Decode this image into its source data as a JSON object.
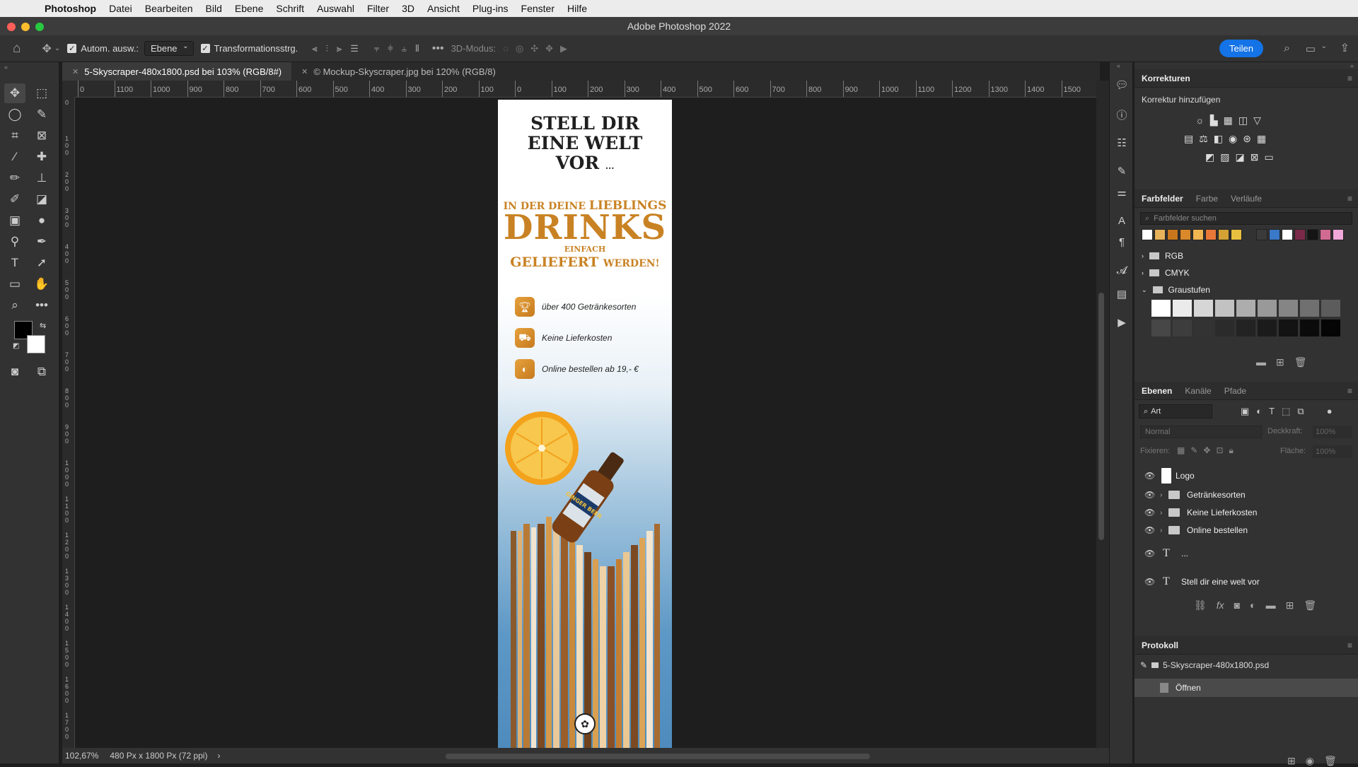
{
  "menubar": {
    "items": [
      "Photoshop",
      "Datei",
      "Bearbeiten",
      "Bild",
      "Ebene",
      "Schrift",
      "Auswahl",
      "Filter",
      "3D",
      "Ansicht",
      "Plug-ins",
      "Fenster",
      "Hilfe"
    ]
  },
  "window": {
    "title": "Adobe Photoshop 2022"
  },
  "options": {
    "auto_select_label": "Autom. ausw.:",
    "auto_select_value": "Ebene",
    "transform_label": "Transformationsstrg.",
    "mode3d_label": "3D-Modus:",
    "share_label": "Teilen"
  },
  "tabs": [
    {
      "label": "5-Skyscraper-480x1800.psd bei 103% (RGB/8#)"
    },
    {
      "label": "© Mockup-Skyscraper.jpg bei 120% (RGB/8)"
    }
  ],
  "rulers": {
    "h": [
      "0",
      "1100",
      "1000",
      "900",
      "800",
      "700",
      "600",
      "500",
      "400",
      "300",
      "200",
      "100",
      "0",
      "100",
      "200",
      "300",
      "400",
      "500",
      "600",
      "700",
      "800",
      "900",
      "1000",
      "1100",
      "1200",
      "1300",
      "1400",
      "1500",
      "1600"
    ],
    "v": [
      "0",
      "1 0 0",
      "2 0 0",
      "3 0 0",
      "4 0 0",
      "5 0 0",
      "6 0 0",
      "7 0 0",
      "8 0 0",
      "9 0 0",
      "1 0 0 0",
      "1 1 0 0",
      "1 2 0 0",
      "1 3 0 0",
      "1 4 0 0",
      "1 5 0 0",
      "1 6 0 0",
      "1 7 0 0"
    ]
  },
  "status": {
    "zoom": "102,67%",
    "doc_info": "480 Px x 1800 Px (72 ppi)",
    "arrow": "›"
  },
  "banner": {
    "headline_1": "STELL DIR",
    "headline_2": "EINE WELT",
    "headline_3": "VOR",
    "headline_ellipsis": "...",
    "sub_a": "IN DER DEINE ",
    "sub_b": "LIEBLINGS",
    "drinks": "DRINKS",
    "einfach": "EINFACH",
    "geliefert": "GELIEFERT ",
    "werden": "WERDEN!",
    "features": [
      {
        "icon": "trophy-icon",
        "text": "über 400 Getränkesorten"
      },
      {
        "icon": "truck-icon",
        "text": "Keine Lieferkosten"
      },
      {
        "icon": "piggy-bank-icon",
        "text": "Online bestellen ab 19,- €"
      }
    ],
    "bottle_label": "GINGER BEER",
    "colors": {
      "accent": "#c98223",
      "dark": "#1f1f1f"
    }
  },
  "panels": {
    "korrekturen": {
      "title": "Korrekturen",
      "subtitle": "Korrektur hinzufügen"
    },
    "farbfelder": {
      "tabs": [
        "Farbfelder",
        "Farbe",
        "Verläufe"
      ],
      "search_placeholder": "Farbfelder suchen",
      "swatches": [
        "#ffffff",
        "#e6b25a",
        "#c8761c",
        "#d9892a",
        "#f0b450",
        "#e87838",
        "#d4a234",
        "#e8c040",
        "#3a3a3a",
        "#3a78c8",
        "#ffffff",
        "#7a2a48",
        "#141414",
        "#d06a90",
        "#f0a8d8"
      ],
      "folders": [
        "RGB",
        "CMYK",
        "Graustufen"
      ],
      "grays": [
        "#ffffff",
        "#ebebeb",
        "#d6d6d6",
        "#c2c2c2",
        "#adadad",
        "#999999",
        "#858585",
        "#707070",
        "#5c5c5c",
        "#474747",
        "#3d3d3d",
        "#333333",
        "#2b2b2b",
        "#232323",
        "#1b1b1b",
        "#131313",
        "#0b0b0b",
        "#050505"
      ]
    },
    "ebenen": {
      "tabs": [
        "Ebenen",
        "Kanäle",
        "Pfade"
      ],
      "filter_label": "Art",
      "blend": "Normal",
      "opacity_label": "Deckkraft:",
      "opacity_value": "100%",
      "lock_label": "Fixieren:",
      "fill_label": "Fläche:",
      "fill_value": "100%",
      "layers": [
        {
          "name": "Logo",
          "kind": "image"
        },
        {
          "name": "Getränkesorten",
          "kind": "group"
        },
        {
          "name": "Keine Lieferkosten",
          "kind": "group"
        },
        {
          "name": "Online bestellen",
          "kind": "group"
        },
        {
          "name": "...",
          "kind": "text"
        },
        {
          "name": "Stell dir eine welt vor",
          "kind": "text"
        }
      ]
    },
    "protokoll": {
      "title": "Protokoll",
      "snapshot": "5-Skyscraper-480x1800.psd",
      "steps": [
        "Öffnen"
      ]
    }
  }
}
